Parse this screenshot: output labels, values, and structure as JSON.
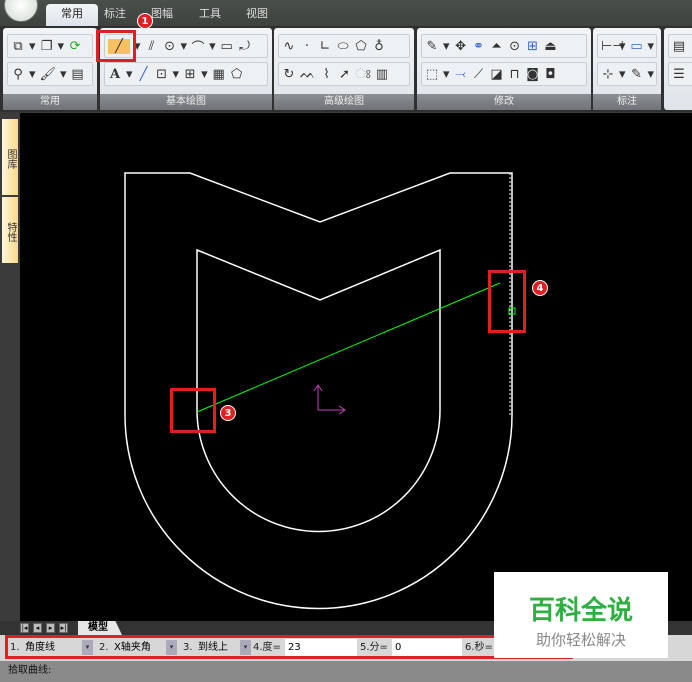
{
  "tabs": [
    "常用",
    "标注",
    "图幅",
    "工具",
    "视图"
  ],
  "ribbon_groups": [
    "常用",
    "基本绘图",
    "高级绘图",
    "修改",
    "标注"
  ],
  "side_tabs": [
    "图库",
    "特性"
  ],
  "model_tab": "模型",
  "command_bar": {
    "f1_label": "1.",
    "f1_value": "角度线",
    "f2_label": "2.",
    "f2_value": "X轴夹角",
    "f3_label": "3.",
    "f3_value": "到线上",
    "f4_label": "4.度=",
    "f4_value": "23",
    "f5_label": "5.分=",
    "f5_value": "0",
    "f6_label": "6.秒="
  },
  "status": "拾取曲线:",
  "watermark": {
    "title": "百科全说",
    "subtitle": "助你轻松解决"
  },
  "badges": [
    "1",
    "3",
    "4"
  ],
  "colors": {
    "accent_red": "#e02020",
    "line_green": "#00ff00",
    "axis_magenta": "#c040c0"
  }
}
